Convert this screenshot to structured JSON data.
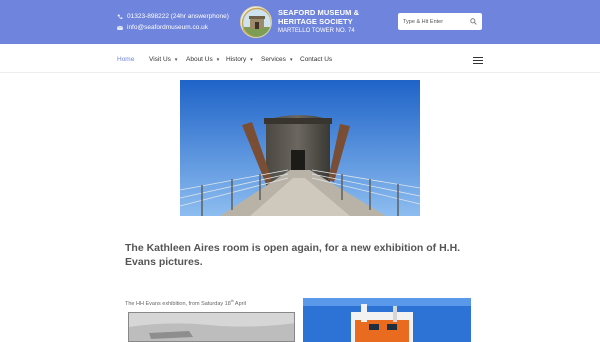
{
  "header": {
    "phone": "01323-898222 (24hr answerphone)",
    "email": "info@seafordmuseum.co.uk",
    "title_line1": "SEAFORD MUSEUM &",
    "title_line2": "HERITAGE SOCIETY",
    "subtitle": "MARTELLO TOWER NO. 74",
    "bg_color": "#6f84dc"
  },
  "search": {
    "placeholder": "Type & Hit Enter"
  },
  "nav": {
    "items": [
      {
        "label": "Home"
      },
      {
        "label": "Visit Us"
      },
      {
        "label": "About Us"
      },
      {
        "label": "History"
      },
      {
        "label": "Services"
      },
      {
        "label": "Contact Us"
      }
    ],
    "active_color": "#6f84dc"
  },
  "main": {
    "headline": "The Kathleen Aires room is open again, for a new exhibition of H.H. Evans pictures.",
    "caption_text": "The HH Evans exhibition, from Saturday 18",
    "caption_sup": "th",
    "caption_end": " April"
  }
}
